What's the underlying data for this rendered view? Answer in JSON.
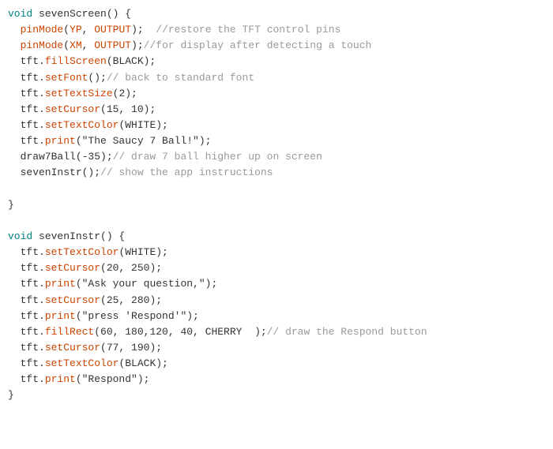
{
  "code": {
    "lines": [
      {
        "id": 1,
        "content": "void sevenScreen() {"
      },
      {
        "id": 2,
        "content": "  pinMode(YP, OUTPUT);  //restore the TFT control pins"
      },
      {
        "id": 3,
        "content": "  pinMode(XM, OUTPUT);//for display after detecting a touch"
      },
      {
        "id": 4,
        "content": "  tft.fillScreen(BLACK);"
      },
      {
        "id": 5,
        "content": "  tft.setFont();// back to standard font"
      },
      {
        "id": 6,
        "content": "  tft.setTextSize(2);"
      },
      {
        "id": 7,
        "content": "  tft.setCursor(15, 10);"
      },
      {
        "id": 8,
        "content": "  tft.setTextColor(WHITE);"
      },
      {
        "id": 9,
        "content": "  tft.print(\"The Saucy 7 Ball!\");"
      },
      {
        "id": 10,
        "content": "  draw7Ball(-35);// draw 7 ball higher up on screen"
      },
      {
        "id": 11,
        "content": "  sevenInstr();// show the app instructions"
      },
      {
        "id": 12,
        "content": ""
      },
      {
        "id": 13,
        "content": "}"
      },
      {
        "id": 14,
        "content": ""
      },
      {
        "id": 15,
        "content": "void sevenInstr() {"
      },
      {
        "id": 16,
        "content": "  tft.setTextColor(WHITE);"
      },
      {
        "id": 17,
        "content": "  tft.setCursor(20, 250);"
      },
      {
        "id": 18,
        "content": "  tft.print(\"Ask your question,\");"
      },
      {
        "id": 19,
        "content": "  tft.setCursor(25, 280);"
      },
      {
        "id": 20,
        "content": "  tft.print(\"press 'Respond'\");"
      },
      {
        "id": 21,
        "content": "  tft.fillRect(60, 180,120, 40, CHERRY  );// draw the Respond button"
      },
      {
        "id": 22,
        "content": "  tft.setCursor(77, 190);"
      },
      {
        "id": 23,
        "content": "  tft.setTextColor(BLACK);"
      },
      {
        "id": 24,
        "content": "  tft.print(\"Respond\");"
      },
      {
        "id": 25,
        "content": "}"
      }
    ]
  }
}
